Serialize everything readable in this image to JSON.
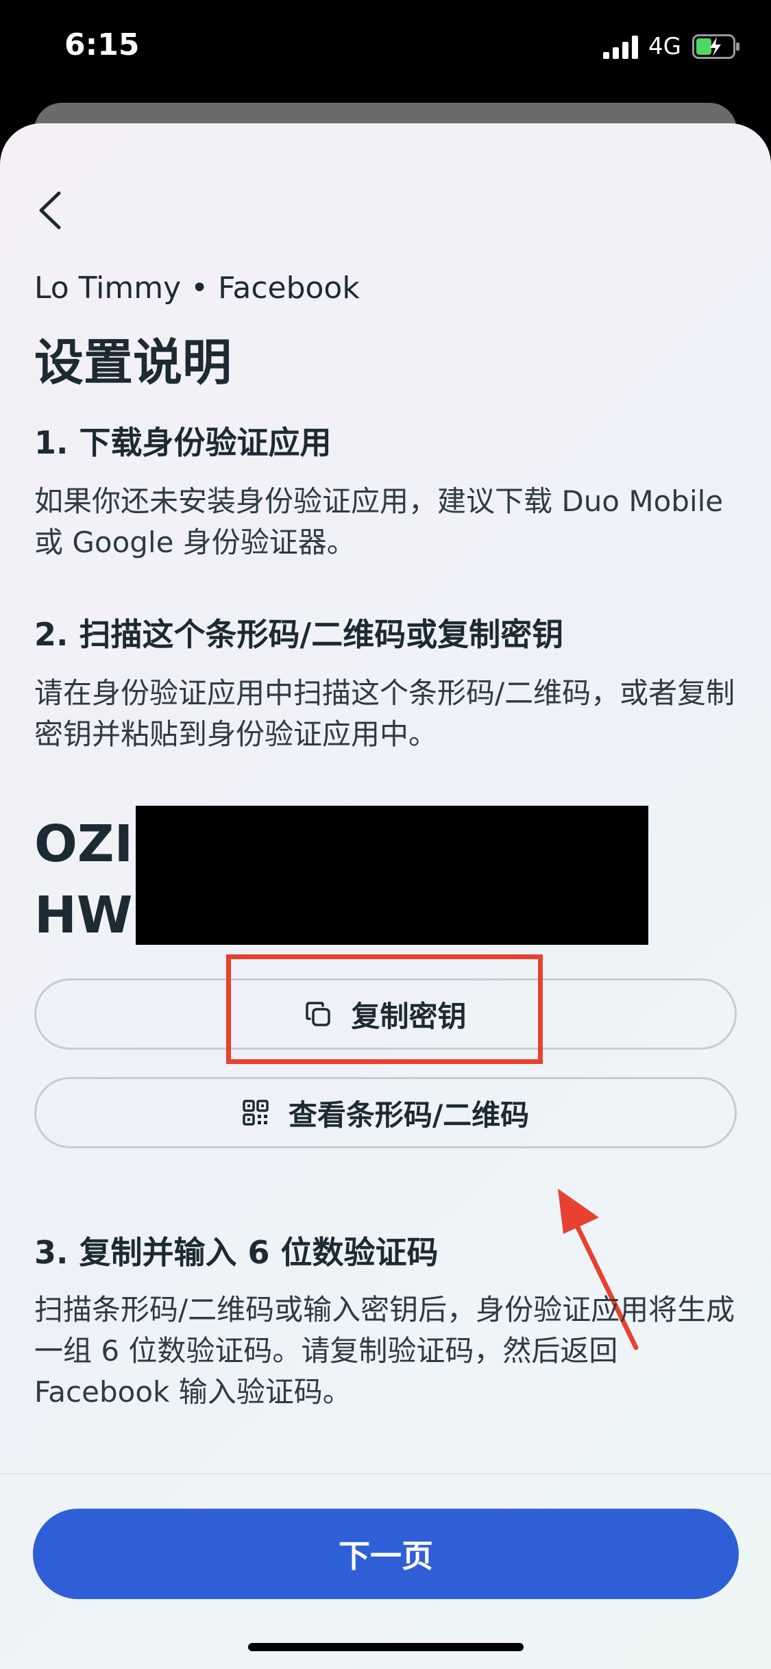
{
  "status_bar": {
    "time": "6:15",
    "network": "4G"
  },
  "header": {
    "account": "Lo Timmy • Facebook",
    "title": "设置说明"
  },
  "steps": [
    {
      "title": "1. 下载身份验证应用",
      "body": "如果你还未安装身份验证应用，建议下载 Duo Mobile 或 Google 身份验证器。"
    },
    {
      "title": "2. 扫描这个条形码/二维码或复制密钥",
      "body": "请在身份验证应用中扫描这个条形码/二维码，或者复制密钥并粘贴到身份验证应用中。"
    },
    {
      "title": "3. 复制并输入 6 位数验证码",
      "body": "扫描条形码/二维码或输入密钥后，身份验证应用将生成一组 6 位数验证码。请复制验证码，然后返回 Facebook 输入验证码。"
    }
  ],
  "secret_key": {
    "line1": "OZII",
    "line2": "HWH"
  },
  "buttons": {
    "copy_key": "复制密钥",
    "view_code": "查看条形码/二维码",
    "next": "下一页"
  },
  "icons": {
    "back": "chevron-left-icon",
    "copy": "copy-icon",
    "qr": "qr-code-icon"
  },
  "colors": {
    "primary": "#2f5fd6",
    "annotation": "#e8412f"
  }
}
